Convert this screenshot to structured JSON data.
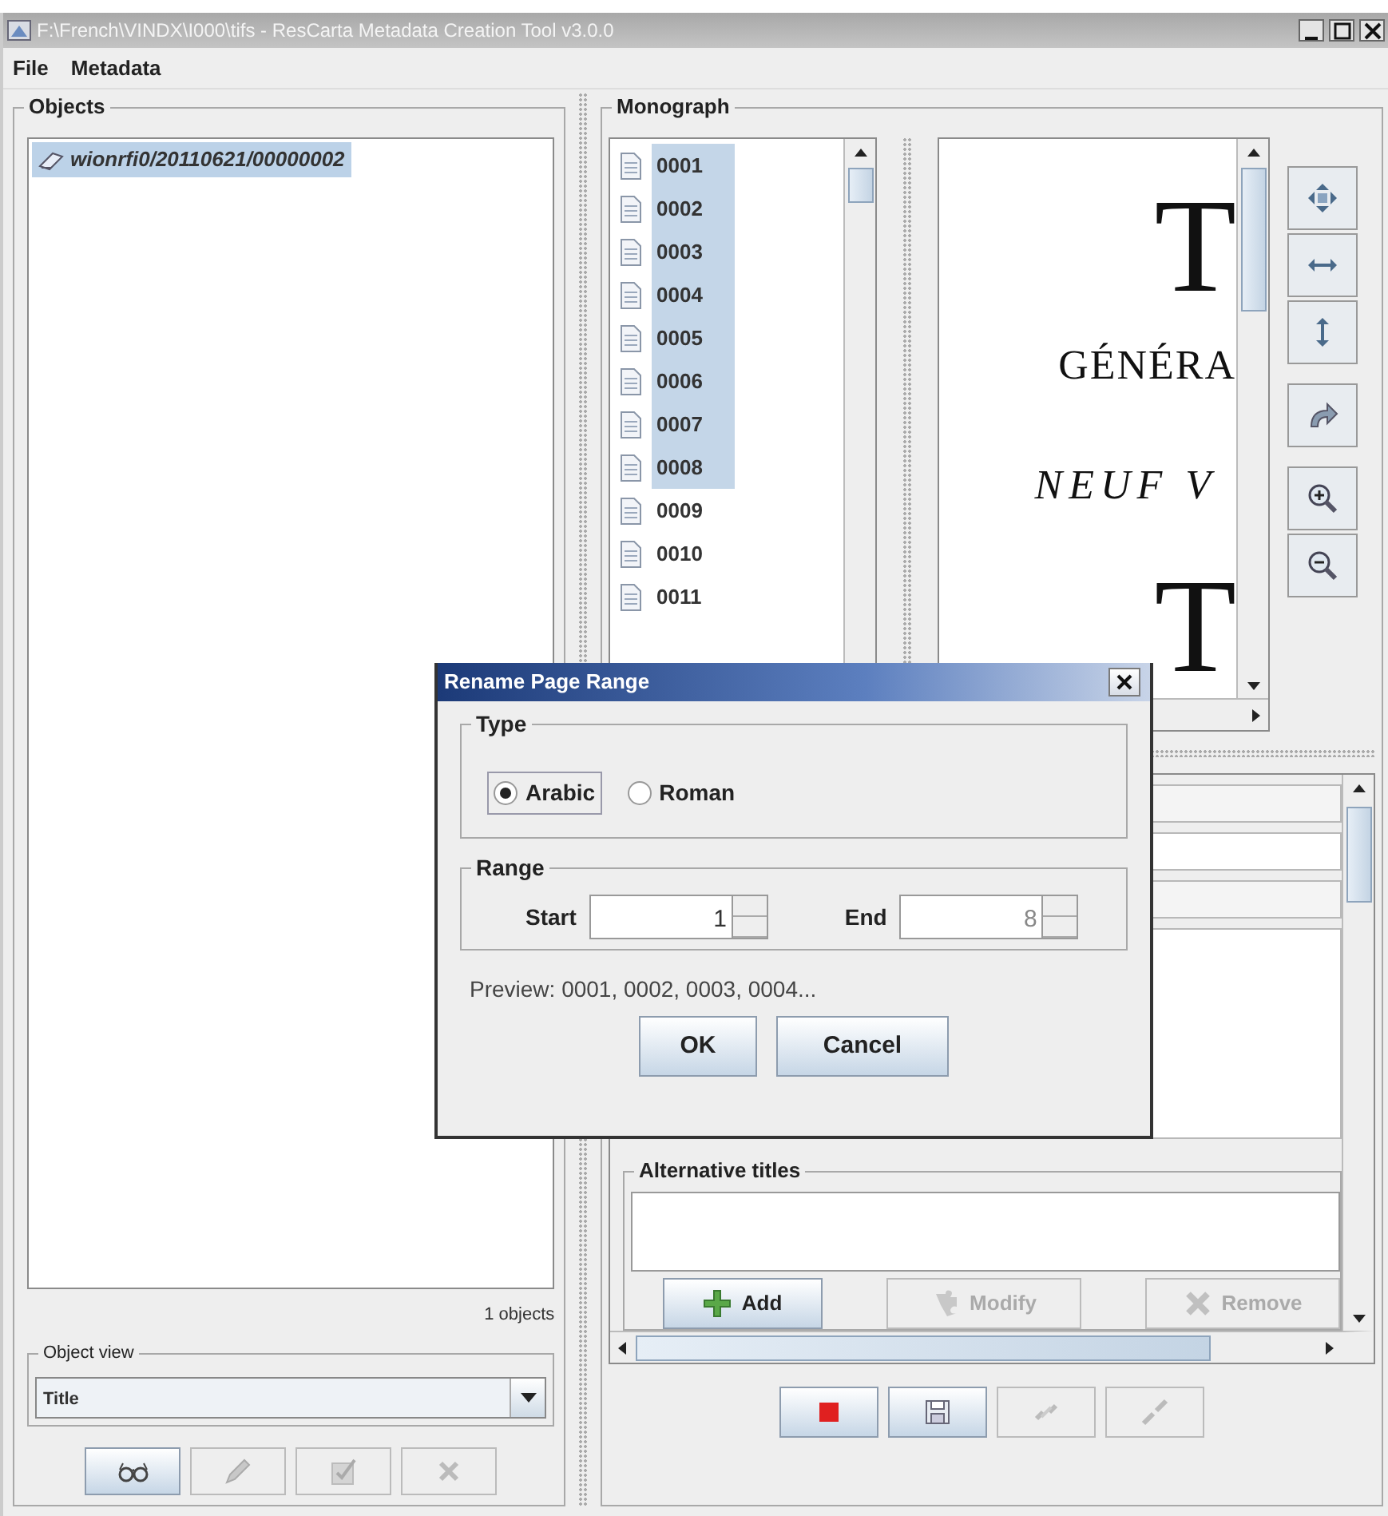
{
  "window": {
    "title": "F:\\French\\VINDX\\I000\\tifs - ResCarta Metadata Creation Tool v3.0.0"
  },
  "menu": [
    {
      "label": "File"
    },
    {
      "label": "Metadata"
    }
  ],
  "objects_panel": {
    "title": "Objects",
    "items": [
      {
        "label": "wionrfi0/20110621/00000002",
        "selected": true
      }
    ],
    "count": "1 objects",
    "object_view": {
      "title": "Object view",
      "value": "Title"
    },
    "buttons": [
      {
        "kind": "view",
        "disabled": false
      },
      {
        "kind": "edit",
        "disabled": true
      },
      {
        "kind": "check",
        "disabled": true
      },
      {
        "kind": "delete",
        "disabled": true
      }
    ]
  },
  "monograph": {
    "title": "Monograph",
    "pages": [
      {
        "label": "0001",
        "selected": true
      },
      {
        "label": "0002",
        "selected": true
      },
      {
        "label": "0003",
        "selected": true
      },
      {
        "label": "0004",
        "selected": true
      },
      {
        "label": "0005",
        "selected": true
      },
      {
        "label": "0006",
        "selected": true
      },
      {
        "label": "0007",
        "selected": true
      },
      {
        "label": "0008",
        "selected": true
      },
      {
        "label": "0009",
        "selected": false
      },
      {
        "label": "0010",
        "selected": false
      },
      {
        "label": "0011",
        "selected": false
      }
    ],
    "document_lines": [
      {
        "kind": "capital",
        "text": "T"
      },
      {
        "kind": "roman",
        "text": "GÉNÉRA"
      },
      {
        "kind": "italic",
        "text": "NEUF V"
      },
      {
        "kind": "capital",
        "text": "T"
      }
    ],
    "viewer_tools": [
      {
        "kind": "move"
      },
      {
        "kind": "fit-width"
      },
      {
        "kind": "fit-height"
      },
      {
        "kind": "rotate"
      },
      {
        "kind": "zoom-in"
      },
      {
        "kind": "zoom-out"
      }
    ],
    "alternative_titles": {
      "title": "Alternative titles",
      "buttons": [
        {
          "kind": "add",
          "label": "Add",
          "disabled": false
        },
        {
          "kind": "modify",
          "label": "Modify",
          "disabled": true
        },
        {
          "kind": "remove",
          "label": "Remove",
          "disabled": true
        }
      ]
    },
    "bottom_buttons": [
      {
        "kind": "stop",
        "disabled": false
      },
      {
        "kind": "save",
        "disabled": false
      },
      {
        "kind": "link",
        "disabled": true
      },
      {
        "kind": "unlink",
        "disabled": true
      }
    ]
  },
  "dialog": {
    "title": "Rename Page Range",
    "type": {
      "title": "Type",
      "options": [
        {
          "label": "Arabic",
          "selected": true
        },
        {
          "label": "Roman",
          "selected": false
        }
      ]
    },
    "range": {
      "title": "Range",
      "start": {
        "label": "Start",
        "value": "1",
        "disabled": false
      },
      "end": {
        "label": "End",
        "value": "8",
        "disabled": true
      }
    },
    "preview": "Preview: 0001, 0002, 0003, 0004...",
    "buttons": [
      {
        "label": "OK"
      },
      {
        "label": "Cancel"
      }
    ]
  }
}
